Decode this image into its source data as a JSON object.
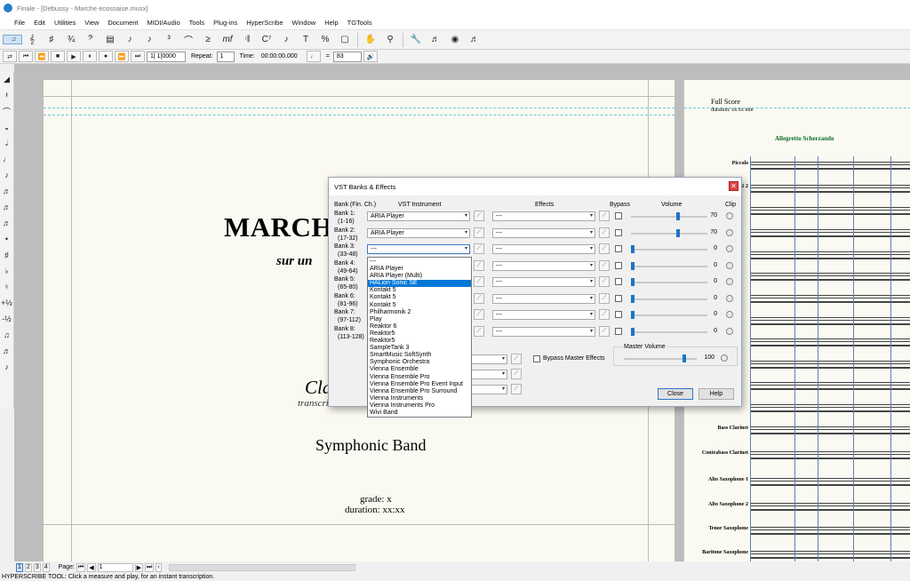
{
  "window": {
    "title": "Finale - [Debussy - Marche ecossaise.musx]"
  },
  "menu": [
    "File",
    "Edit",
    "Utilities",
    "View",
    "Document",
    "MIDI/Audio",
    "Tools",
    "Plug-ins",
    "HyperScribe",
    "Window",
    "Help",
    "TGTools"
  ],
  "playback": {
    "measure": "1| 1|0000",
    "repeat_label": "Repeat:",
    "repeat_value": "1",
    "time_label": "Time:",
    "time_value": "00:00:00.000",
    "equals": "=",
    "tempo": "83"
  },
  "title_page": {
    "title": "MARCHI",
    "subtitle": "sur un",
    "composer": "Cla",
    "transcribed": "transcri",
    "ensemble": "Symphonic Band",
    "grade": "grade: x",
    "duration": "duration: xx:xx"
  },
  "score_page": {
    "title": "Full Score",
    "duration": "duration: xx:xx min",
    "tempo_marking": "Allegretto Scherzando",
    "instruments": [
      {
        "name": "Piccolo"
      },
      {
        "name": "Bob Flute 1 2"
      },
      {
        "name": ""
      },
      {
        "name": ""
      },
      {
        "name": ""
      },
      {
        "name": ""
      },
      {
        "name": ""
      },
      {
        "name": ""
      },
      {
        "name": ""
      },
      {
        "name": ""
      },
      {
        "name": ""
      },
      {
        "name": ""
      },
      {
        "name": "Bass Clarinet"
      },
      {
        "name": "Contrabass Clarinet"
      },
      {
        "name": "Alto Saxophone 1"
      },
      {
        "name": "Alto Saxophone 2"
      },
      {
        "name": "Tenor Saxophone"
      },
      {
        "name": "Baritone Saxophone"
      }
    ]
  },
  "dialog": {
    "title": "VST Banks & Effects",
    "headers": {
      "bank": "Bank (Fin. Ch.)",
      "instrument": "VST Instrument",
      "effects": "Effects",
      "bypass": "Bypass",
      "volume": "Volume",
      "clip": "Clip"
    },
    "banks": [
      {
        "label": "Bank 1:",
        "range": "(1-16)",
        "instrument": "ARIA Player",
        "effect": "---",
        "volume": "70",
        "level": 0.62
      },
      {
        "label": "Bank 2:",
        "range": "(17-32)",
        "instrument": "ARIA Player",
        "effect": "---",
        "volume": "70",
        "level": 0.62
      },
      {
        "label": "Bank 3:",
        "range": "(33-48)",
        "instrument": "---",
        "effect": "---",
        "volume": "0",
        "level": 0
      },
      {
        "label": "Bank 4:",
        "range": "(49-64)",
        "instrument": "",
        "effect": "---",
        "volume": "0",
        "level": 0
      },
      {
        "label": "Bank 5:",
        "range": "(65-80)",
        "instrument": "",
        "effect": "---",
        "volume": "0",
        "level": 0
      },
      {
        "label": "Bank 6:",
        "range": "(81-96)",
        "instrument": "",
        "effect": "---",
        "volume": "0",
        "level": 0
      },
      {
        "label": "Bank 7:",
        "range": "(97-112)",
        "instrument": "",
        "effect": "---",
        "volume": "0",
        "level": 0
      },
      {
        "label": "Bank 8:",
        "range": "(113-128)",
        "instrument": "",
        "effect": "---",
        "volume": "0",
        "level": 0
      }
    ],
    "bypass_master": "Bypass Master Effects",
    "master_volume_label": "Master Volume",
    "master_volume": "100",
    "master_level": 0.83,
    "close_label": "Close",
    "help_label": "Help",
    "dropdown_options": [
      "---",
      "ARIA Player",
      "ARIA Player (Multi)",
      "HALion Sonic SE",
      "Kontakt 5",
      "Kontakt 5",
      "Kontakt 5",
      "Philharmonik 2",
      "Play",
      "Reaktor 6",
      "Reaktor5",
      "Reaktor5",
      "SampleTank 3",
      "SmartMusic SoftSynth",
      "Symphonic Orchestra",
      "Vienna Ensemble",
      "Vienna Ensemble Pro",
      "Vienna Ensemble Pro Event Input",
      "Vienna Ensemble Pro Surround",
      "Vienna Instruments",
      "Vienna Instruments Pro",
      "Wivi Band"
    ],
    "dropdown_highlighted": 3
  },
  "pagebar": {
    "pages": [
      "1",
      "2",
      "3",
      "4"
    ],
    "page_label": "Page:",
    "page_value": "1"
  },
  "status": {
    "text": "HYPERSCRIBE TOOL: Click a measure and play, for an instant transcription."
  }
}
